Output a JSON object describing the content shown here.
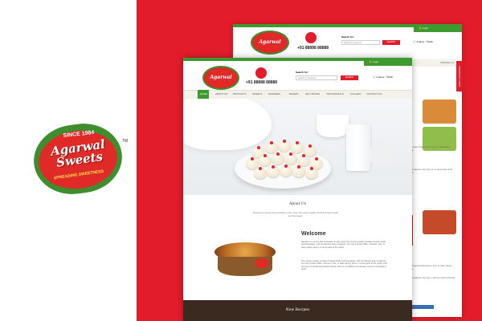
{
  "logo": {
    "since": "SINCE 1984",
    "brand_line1": "Agarwal",
    "brand_line2": "Sweets",
    "tagline": "SPREADING SWEETNESS",
    "tm": "TM"
  },
  "site": {
    "login": "Login",
    "phone": "+91 88888 88888",
    "search_label": "Search for:",
    "search_placeholder": "Search for products",
    "search_button": "SEARCH",
    "cart": "0 items - ₹0.00",
    "nav": [
      "HOME",
      "ABOUT US",
      "PRODUCTS",
      "SWEETS",
      "NAMKEEN",
      "BAKERY",
      "GIFT BOXES",
      "TESTIMONIALS",
      "GALLERY",
      "CONTACT US"
    ],
    "back_nav_last": "CONTACT U",
    "feedback_tab": "FEEDBACK FORM"
  },
  "about": {
    "title": "About Us",
    "text": "Dessert is a course that concludes a main meal. The course usually consists of sweet foods and beverages."
  },
  "welcome": {
    "title": "Welcome",
    "para1": "Dessert is a course that concludes a main meal. The course usually consists of sweet foods and beverages, such as dessert wine or liqueurs, but may include coffee, cheeses, nuts, or other savory items. In some parts of the world.",
    "para2": "The course usually consists of sweet foods and beverages, such as dessert wine or liqueurs, but may include coffee, cheeses, nuts, or other savory items. In some parts of the world, such as much of central and western Africa, there is no tradition of a dessert course to conclude a meal."
  },
  "back_page_text": {
    "p1": "ts of sweet foods and as, nuts, or other savory items.",
    "p2": "ine or liqueurs, but may ms. In some parts of the world.",
    "p3": "sts of sweet foods and es, nuts, or other savory items.",
    "p4": "ine or liqueurs, but may s, such as much of central and"
  },
  "recipes": {
    "title": "New Recipes"
  },
  "colors": {
    "brand_red": "#e31c2c",
    "brand_green": "#3d9a2f"
  }
}
